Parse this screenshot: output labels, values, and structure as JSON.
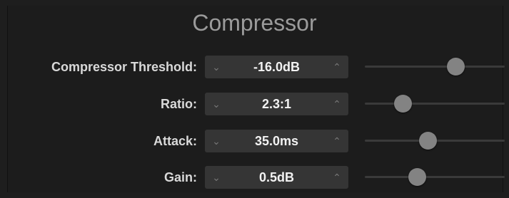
{
  "title": "Compressor",
  "controls": [
    {
      "label": "Compressor Threshold:",
      "value": "-16.0dB",
      "slider_fraction": 0.65
    },
    {
      "label": "Ratio:",
      "value": "2.3:1",
      "slider_fraction": 0.27
    },
    {
      "label": "Attack:",
      "value": "35.0ms",
      "slider_fraction": 0.45
    },
    {
      "label": "Gain:",
      "value": "0.5dB",
      "slider_fraction": 0.37
    }
  ],
  "icons": {
    "decrement": "chevron-down-icon",
    "increment": "chevron-up-icon"
  },
  "colors": {
    "background": "#1e1e1e",
    "title": "#9b9b9b",
    "field": "#353535",
    "thumb": "#838383"
  }
}
